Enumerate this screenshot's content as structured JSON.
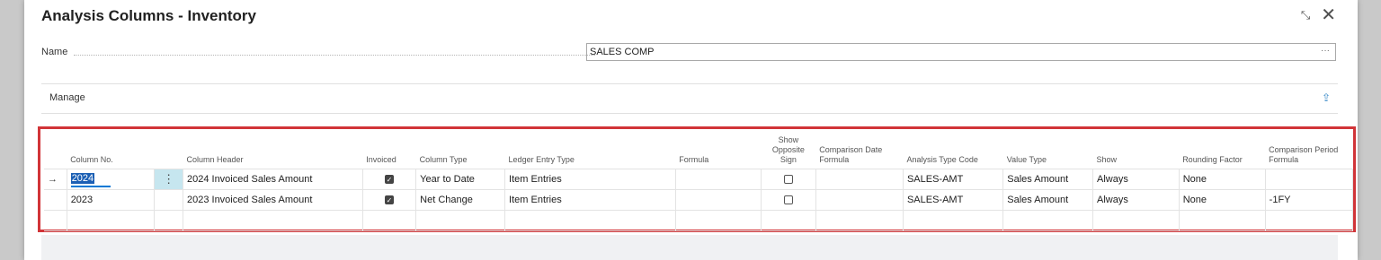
{
  "dialog": {
    "title": "Analysis Columns - Inventory",
    "collapse_icon": "collapse-arrows-icon",
    "close_icon": "close-icon"
  },
  "name_field": {
    "label": "Name",
    "value": "SALES COMP",
    "more_label": "···"
  },
  "actions": {
    "manage_label": "Manage",
    "share_icon": "share-icon"
  },
  "grid": {
    "columns": {
      "column_no": "Column No.",
      "column_header": "Column Header",
      "invoiced": "Invoiced",
      "column_type": "Column Type",
      "ledger_entry_type": "Ledger Entry Type",
      "formula": "Formula",
      "show_opposite_sign_1": "Show",
      "show_opposite_sign_2": "Opposite",
      "show_opposite_sign_3": "Sign",
      "comparison_date_formula_1": "Comparison Date",
      "comparison_date_formula_2": "Formula",
      "analysis_type_code": "Analysis Type Code",
      "value_type": "Value Type",
      "show": "Show",
      "rounding_factor": "Rounding Factor",
      "comparison_period_formula_1": "Comparison Period",
      "comparison_period_formula_2": "Formula"
    },
    "rows": [
      {
        "indicator": "→",
        "column_no": "2024",
        "menu": "⋮",
        "column_header": "2024 Invoiced Sales Amount",
        "invoiced": true,
        "column_type": "Year to Date",
        "ledger_entry_type": "Item Entries",
        "formula": "",
        "show_opposite_sign": false,
        "comparison_date_formula": "",
        "analysis_type_code": "SALES-AMT",
        "value_type": "Sales Amount",
        "show": "Always",
        "rounding_factor": "None",
        "comparison_period_formula": ""
      },
      {
        "indicator": "",
        "column_no": "2023",
        "menu": "",
        "column_header": "2023 Invoiced Sales Amount",
        "invoiced": true,
        "column_type": "Net Change",
        "ledger_entry_type": "Item Entries",
        "formula": "",
        "show_opposite_sign": false,
        "comparison_date_formula": "",
        "analysis_type_code": "SALES-AMT",
        "value_type": "Sales Amount",
        "show": "Always",
        "rounding_factor": "None",
        "comparison_period_formula": "-1FY"
      }
    ]
  },
  "colors": {
    "highlight_border": "#d13438",
    "selection": "#1b5fb4",
    "menu_cell": "#c6e6ef",
    "accent": "#0078d4"
  }
}
